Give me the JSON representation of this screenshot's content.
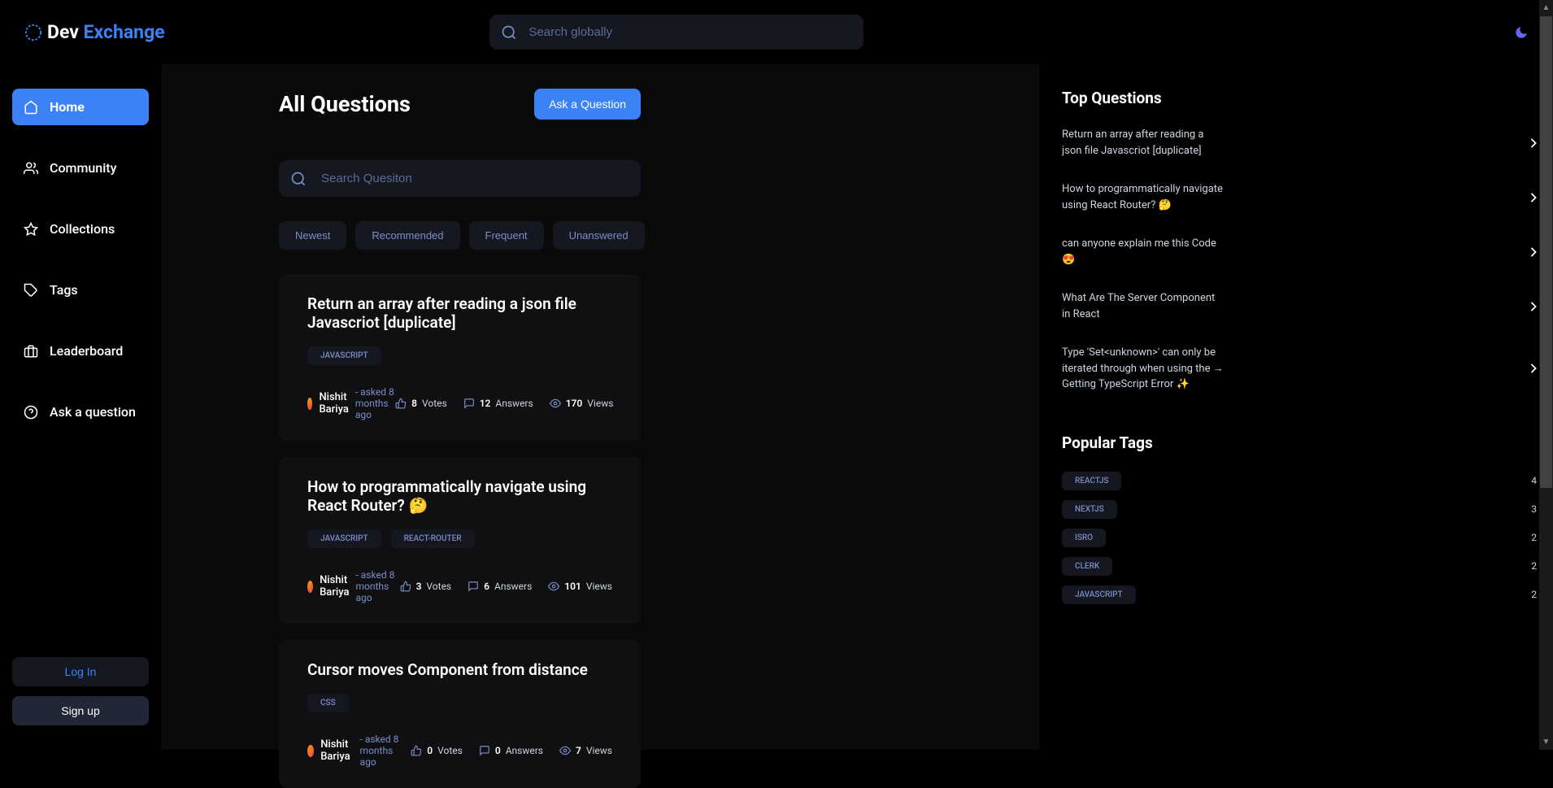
{
  "header": {
    "logo_dev": "Dev",
    "logo_exchange": " Exchange",
    "search_placeholder": "Search globally"
  },
  "sidebar": {
    "items": [
      {
        "label": "Home",
        "icon": "home"
      },
      {
        "label": "Community",
        "icon": "users"
      },
      {
        "label": "Collections",
        "icon": "star"
      },
      {
        "label": "Tags",
        "icon": "tag"
      },
      {
        "label": "Leaderboard",
        "icon": "briefcase"
      },
      {
        "label": "Ask a question",
        "icon": "question"
      }
    ],
    "login_label": "Log In",
    "signup_label": "Sign up"
  },
  "main": {
    "page_title": "All Questions",
    "ask_button": "Ask a Question",
    "search_placeholder": "Search Quesiton",
    "filters": [
      "Newest",
      "Recommended",
      "Frequent",
      "Unanswered"
    ],
    "questions": [
      {
        "title": "Return an array after reading a json file Javascriot [duplicate]",
        "tags": [
          "JAVASCRIPT"
        ],
        "author": "Nishit Bariya",
        "time": "- asked 8 months ago",
        "votes": "8",
        "votes_label": "Votes",
        "answers": "12",
        "answers_label": "Answers",
        "views": "170",
        "views_label": "Views"
      },
      {
        "title": "How to programmatically navigate using React Router? 🤔",
        "tags": [
          "JAVASCRIPT",
          "REACT-ROUTER"
        ],
        "author": "Nishit Bariya",
        "time": "- asked 8 months ago",
        "votes": "3",
        "votes_label": "Votes",
        "answers": "6",
        "answers_label": "Answers",
        "views": "101",
        "views_label": "Views"
      },
      {
        "title": "Cursor moves Component from distance",
        "tags": [
          "CSS"
        ],
        "author": "Nishit Bariya",
        "time": "- asked 8 months ago",
        "votes": "0",
        "votes_label": "Votes",
        "answers": "0",
        "answers_label": "Answers",
        "views": "7",
        "views_label": "Views"
      }
    ]
  },
  "right": {
    "top_title": "Top Questions",
    "top_questions": [
      "Return an array after reading a json file Javascriot [duplicate]",
      "How to programmatically navigate using React Router? 🤔",
      "can anyone explain me this Code 😍",
      "What Are The Server Component in React",
      "Type 'Set<unknown>' can only be iterated through when using the → Getting TypeScript Error ✨"
    ],
    "popular_title": "Popular Tags",
    "popular_tags": [
      {
        "name": "REACTJS",
        "count": "4"
      },
      {
        "name": "NEXTJS",
        "count": "3"
      },
      {
        "name": "ISRO",
        "count": "2"
      },
      {
        "name": "CLERK",
        "count": "2"
      },
      {
        "name": "JAVASCRIPT",
        "count": "2"
      }
    ]
  }
}
